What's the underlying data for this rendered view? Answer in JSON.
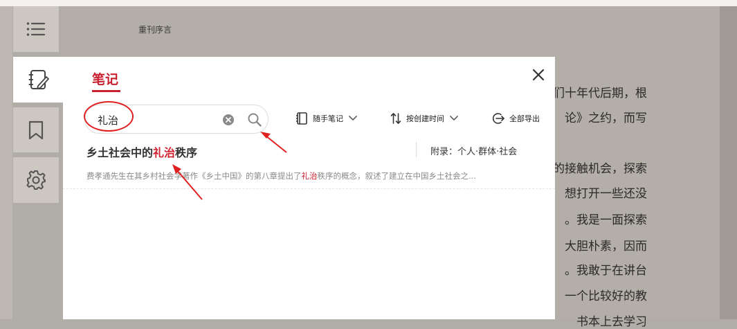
{
  "reader": {
    "chapter_title": "重刊序言",
    "background_lines": [
      "们十年代后期，根",
      "论》之约，而写",
      "的接触机会，探索",
      "想打开一些还没",
      "。我是一面探索",
      "大胆朴素，因而",
      "。我敢于在讲台",
      "一个比较好的教",
      "书本上去学习"
    ]
  },
  "sidebar": {
    "items": [
      {
        "icon": "menu-icon"
      },
      {
        "icon": "notes-icon"
      },
      {
        "icon": "bookmark-icon"
      },
      {
        "icon": "gear-icon"
      }
    ]
  },
  "notes_panel": {
    "title": "笔记",
    "search": {
      "value": "礼治"
    },
    "toolbar": {
      "filter_label": "随手笔记",
      "sort_label": "按创建时间",
      "export_label": "全部导出"
    },
    "results": [
      {
        "title_before": "乡土社会中的",
        "title_highlight": "礼治",
        "title_after": "秩序",
        "chapter": "附录：个人·群体·社会",
        "excerpt_before": "费孝通先生在其乡村社会学著作《乡土中国》的第八章提出了",
        "excerpt_highlight": "礼治",
        "excerpt_after": "秩序的概念，叙述了建立在中国乡土社会之..."
      }
    ]
  },
  "colors": {
    "accent": "#c8202f",
    "annotation": "#e02020",
    "reader_bg": "#b3aea7"
  }
}
